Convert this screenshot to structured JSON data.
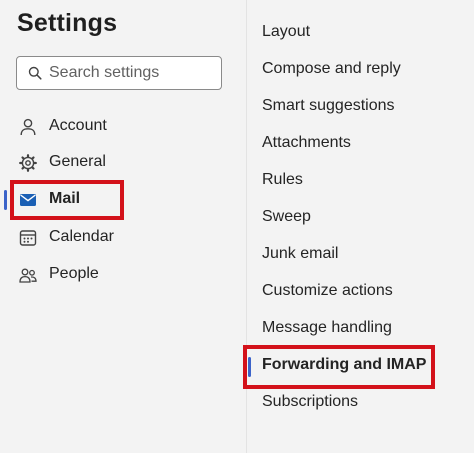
{
  "settings": {
    "title": "Settings",
    "search_placeholder": "Search settings"
  },
  "nav": {
    "items": [
      {
        "label": "Account",
        "icon": "person-icon"
      },
      {
        "label": "General",
        "icon": "gear-icon"
      },
      {
        "label": "Mail",
        "icon": "envelope-icon",
        "selected": true
      },
      {
        "label": "Calendar",
        "icon": "calendar-icon"
      },
      {
        "label": "People",
        "icon": "people-icon"
      }
    ]
  },
  "mail_settings": {
    "items": [
      {
        "label": "Layout"
      },
      {
        "label": "Compose and reply"
      },
      {
        "label": "Smart suggestions"
      },
      {
        "label": "Attachments"
      },
      {
        "label": "Rules"
      },
      {
        "label": "Sweep"
      },
      {
        "label": "Junk email"
      },
      {
        "label": "Customize actions"
      },
      {
        "label": "Message handling"
      },
      {
        "label": "Forwarding and IMAP",
        "selected": true
      },
      {
        "label": "Subscriptions"
      }
    ]
  },
  "colors": {
    "accent": "#3b63c9",
    "highlight_box": "#d3111a",
    "mail_icon": "#1a5fb4",
    "background": "#f3f3f3"
  }
}
